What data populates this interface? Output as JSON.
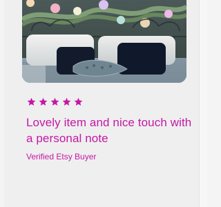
{
  "review": {
    "rating": 5,
    "rating_max": 5,
    "text": "Lovely item and nice touch with a personal note",
    "buyer_label": "Verified Etsy Buyer"
  },
  "colors": {
    "accent": "#c517a7",
    "background": "#efefef"
  },
  "icons": {
    "star": "star-icon"
  }
}
